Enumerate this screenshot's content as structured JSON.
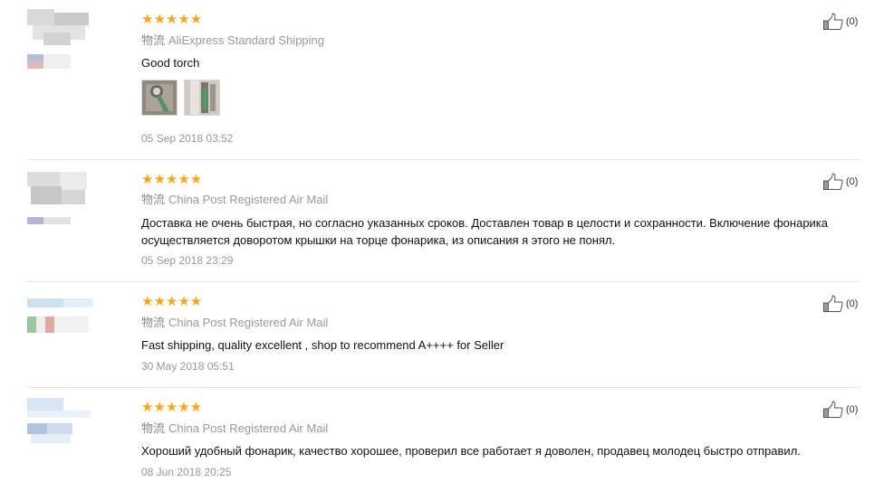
{
  "reviews": [
    {
      "stars": "★★★★★",
      "shipping_label": "物流",
      "shipping": "AliExpress Standard Shipping",
      "text": "Good torch",
      "date": "05 Sep 2018 03:52",
      "helpful": "(0)",
      "photos": 2
    },
    {
      "stars": "★★★★★",
      "shipping_label": "物流",
      "shipping": "China Post Registered Air Mail",
      "text": "Доставка не очень быстрая, но согласно указанных сроков. Доставлен товар в целости и сохранности. Включение фонарика осуществляется доворотом крышки на торце фонарика, из описания я этого не понял.",
      "date": "05 Sep 2018 23:29",
      "helpful": "(0)"
    },
    {
      "stars": "★★★★★",
      "shipping_label": "物流",
      "shipping": "China Post Registered Air Mail",
      "text": "Fast shipping, quality excellent , shop to recommend A++++ for Seller",
      "date": "30 May 2018 05:51",
      "helpful": "(0)"
    },
    {
      "stars": "★★★★★",
      "shipping_label": "物流",
      "shipping": "China Post Registered Air Mail",
      "text": "Хороший удобный фонарик, качество хорошее, проверил все работает я доволен, продавец молодец быстро отправил.",
      "date": "08 Jun 2018 20:25",
      "helpful": "(0)"
    }
  ],
  "icons": {
    "helpful": "thumbs-up-icon",
    "rating": "star-icon"
  },
  "colors": {
    "star": "#f6a623",
    "meta": "#999999",
    "divider": "#e8e8e8"
  }
}
